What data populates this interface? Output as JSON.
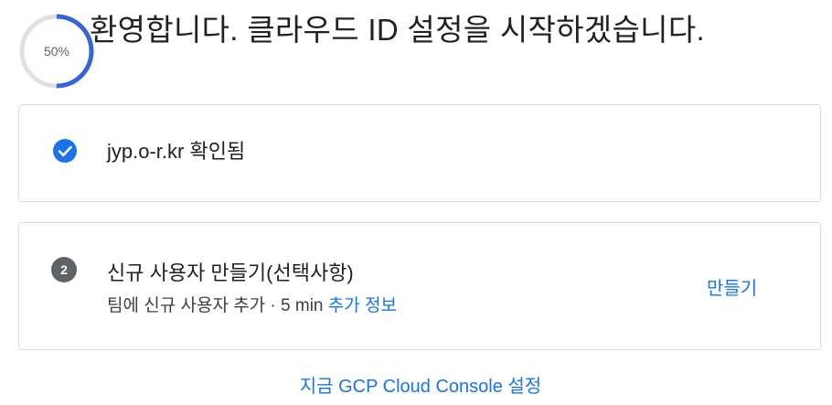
{
  "header": {
    "progress_label": "50%",
    "progress_value": 0.5,
    "title": "환영합니다. 클라우드 ID 설정을 시작하겠습니다."
  },
  "step1": {
    "icon": "check-circle-icon",
    "text": "jyp.o-r.kr 확인됨"
  },
  "step2": {
    "number": "2",
    "title": "신규 사용자 만들기(선택사항)",
    "subtitle": "팀에 신규 사용자 추가 · 5 min",
    "more_info_link": "추가 정보",
    "action_label": "만들기"
  },
  "footer": {
    "link": "지금 GCP Cloud Console 설정"
  },
  "colors": {
    "accent": "#1a73e8",
    "progress_track": "#e0e0e0",
    "progress_fill": "#3367d6",
    "step_badge": "#5f6368"
  }
}
